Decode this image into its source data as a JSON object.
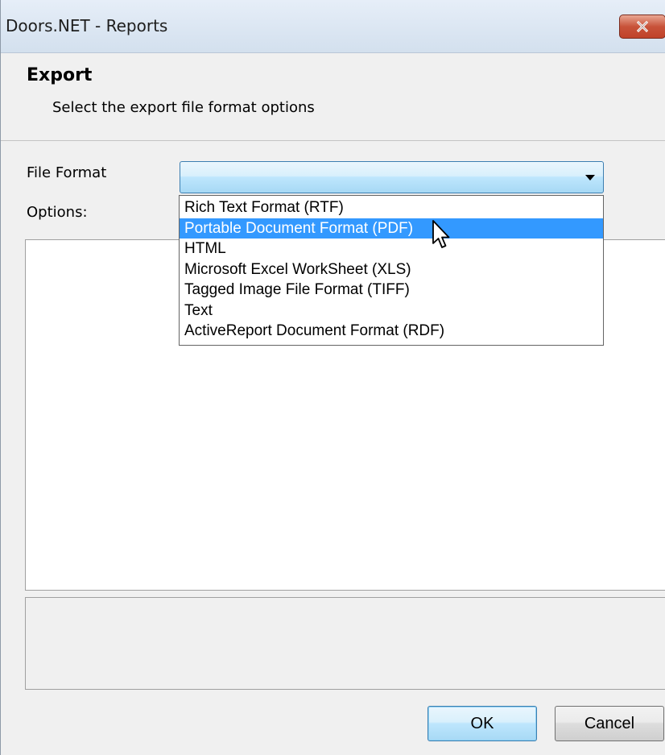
{
  "window": {
    "title": "Doors.NET - Reports"
  },
  "header": {
    "title": "Export",
    "subtitle": "Select the export file format options"
  },
  "form": {
    "file_format_label": "File Format",
    "options_label": "Options:",
    "file_format_value": "",
    "dropdown_options": [
      "Rich Text Format (RTF)",
      "Portable Document Format (PDF)",
      "HTML",
      "Microsoft Excel WorkSheet (XLS)",
      "Tagged Image File Format (TIFF)",
      "Text",
      "ActiveReport Document Format (RDF)"
    ],
    "highlighted_option": "Portable Document Format (PDF)"
  },
  "buttons": {
    "ok_label": "OK",
    "cancel_label": "Cancel"
  },
  "icons": {
    "close": "close-icon",
    "dropdown_arrow": "chevron-down-icon",
    "cursor": "mouse-pointer-icon"
  },
  "colors": {
    "selection": "#3399ff",
    "close_button": "#c8533a",
    "combo_focus": "#bee6fd"
  }
}
